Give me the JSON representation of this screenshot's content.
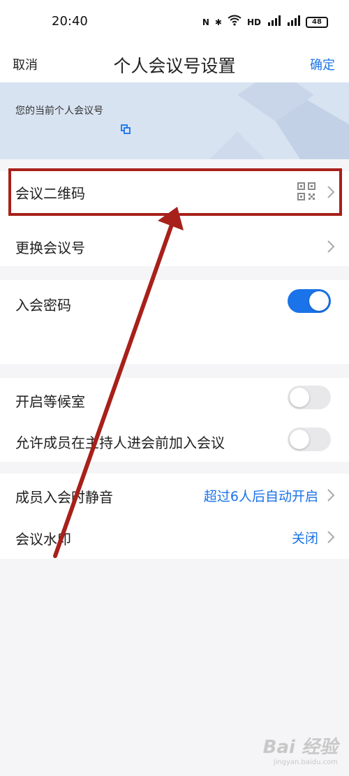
{
  "status": {
    "time": "20:40",
    "battery": "48",
    "icons": [
      "nfc-icon",
      "bluetooth-icon",
      "wifi-icon",
      "hd-icon",
      "signal-5g-icon",
      "signal-4g-icon"
    ]
  },
  "nav": {
    "cancel": "取消",
    "title": "个人会议号设置",
    "confirm": "确定"
  },
  "banner": {
    "label": "您的当前个人会议号"
  },
  "rows": {
    "qr": {
      "label": "会议二维码"
    },
    "change": {
      "label": "更换会议号"
    },
    "password": {
      "label": "入会密码",
      "enabled": true
    },
    "waiting": {
      "label": "开启等候室",
      "enabled": false
    },
    "early_join": {
      "label": "允许成员在主持人进会前加入会议",
      "enabled": false
    },
    "mute": {
      "label": "成员入会时静音",
      "value": "超过6人后自动开启"
    },
    "watermark": {
      "label": "会议水印",
      "value": "关闭"
    }
  },
  "colors": {
    "accent": "#1a73e8",
    "annotation": "#a8201a"
  },
  "page_watermark": {
    "main": "Bai 经验",
    "sub": "jingyan.baidu.com"
  }
}
